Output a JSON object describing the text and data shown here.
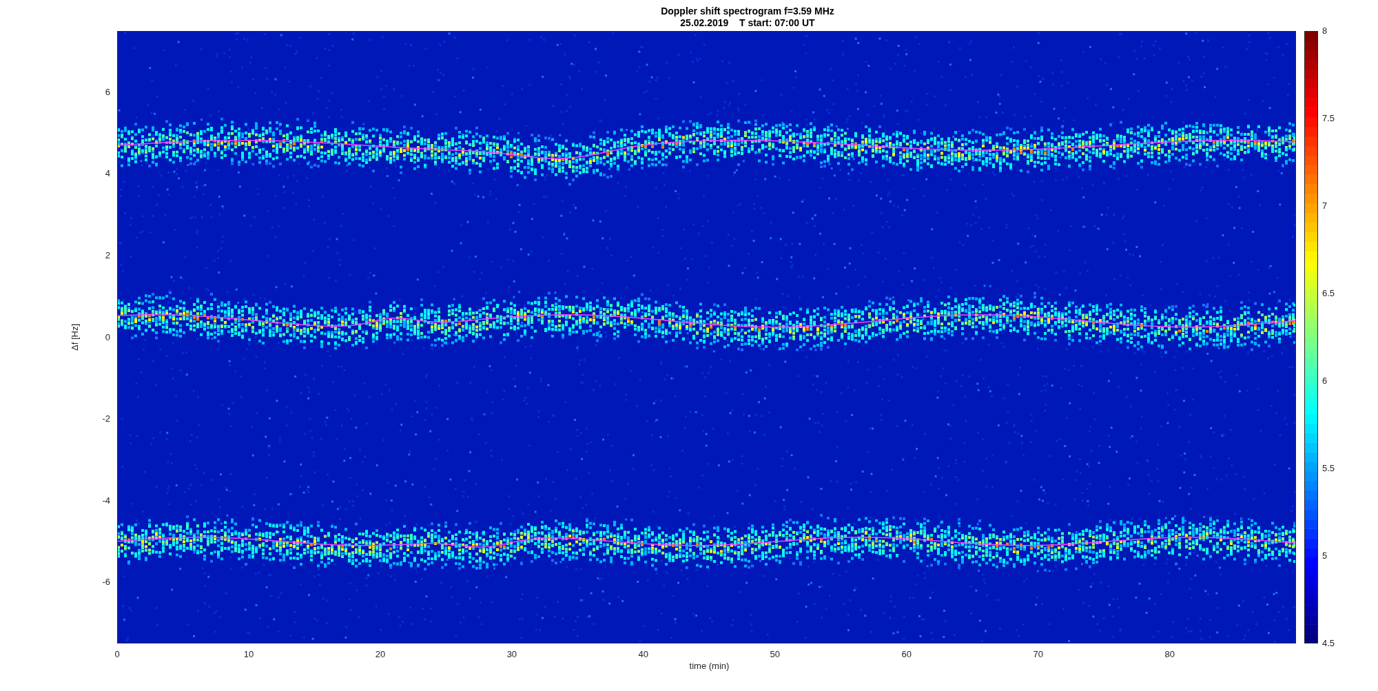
{
  "title": {
    "line_1": "Doppler shift spectrogram f=3.59 MHz",
    "line_2": "25.02.2019    T start: 07:00 UT"
  },
  "plot": {
    "ylabel": "Δf [Hz]",
    "xlabel": "time (min)",
    "yticks": [
      "6",
      "4",
      "2",
      "0",
      "-2",
      "-4",
      "-6"
    ],
    "xticks": [
      "0",
      "10",
      "20",
      "30",
      "40",
      "50",
      "60",
      "70",
      "80"
    ]
  },
  "colorbar": {
    "ticks": [
      "8",
      "7.5",
      "7",
      "6.5",
      "6",
      "5.5",
      "5",
      "4.5"
    ]
  }
}
